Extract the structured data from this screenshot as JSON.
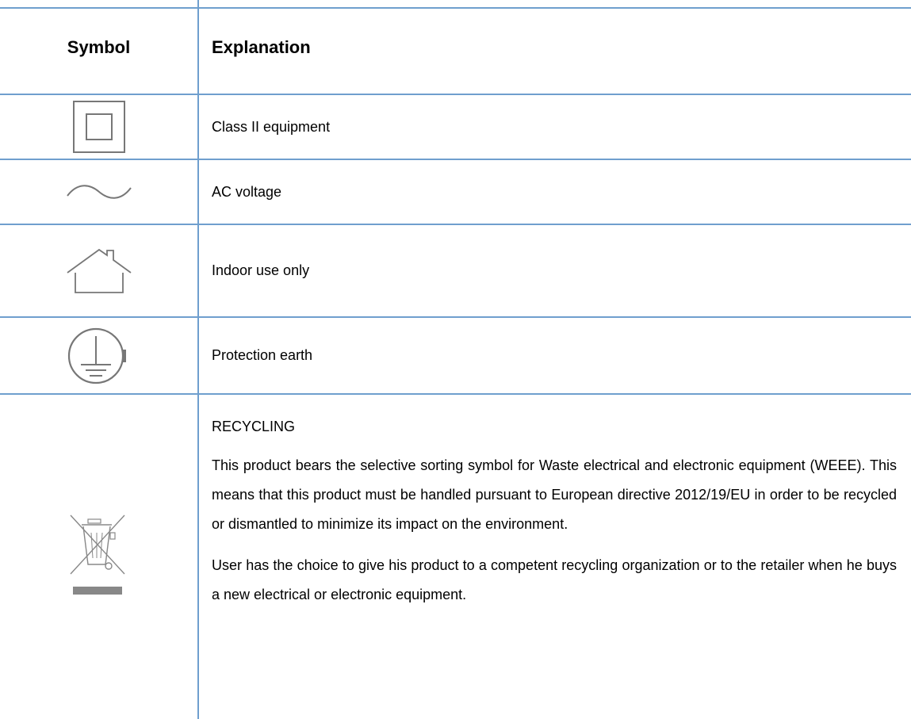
{
  "header": {
    "symbol_label": "Symbol",
    "explanation_label": "Explanation"
  },
  "rows": [
    {
      "icon": "class-ii-equipment-icon",
      "text": "Class II equipment"
    },
    {
      "icon": "ac-voltage-icon",
      "text": "AC voltage"
    },
    {
      "icon": "indoor-use-icon",
      "text": "Indoor use only"
    },
    {
      "icon": "protection-earth-icon",
      "text": "Protection earth"
    }
  ],
  "recycling": {
    "icon": "weee-crossed-bin-icon",
    "title": "RECYCLING",
    "paragraph1": "This product bears the selective sorting symbol for Waste electrical and electronic equipment (WEEE). This means that this product must be handled pursuant to European directive 2012/19/EU in order to be recycled or dismantled to minimize its impact on the environment.",
    "paragraph2": "User has the choice to give his product to a competent recycling organization or to the retailer when he buys a new electrical or electronic equipment."
  },
  "colors": {
    "grid_line": "#6f9fce",
    "icon_stroke": "#777777"
  }
}
